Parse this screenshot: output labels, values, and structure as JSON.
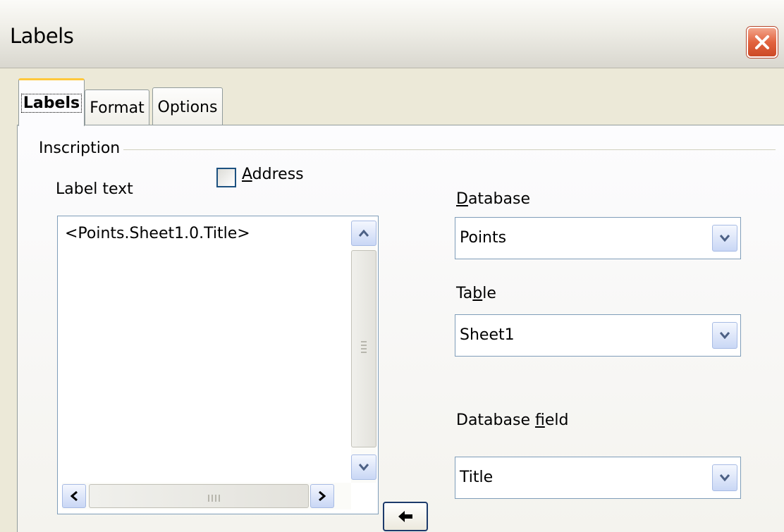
{
  "window": {
    "title": "Labels",
    "close_icon": "close-x-icon"
  },
  "tabs": [
    {
      "label": "Labels",
      "active": true
    },
    {
      "label": "Format",
      "active": false
    },
    {
      "label": "Options",
      "active": false
    }
  ],
  "inscription": {
    "group_title": "Inscription",
    "label_text_caption": "Label text",
    "address_checkbox": {
      "label": "Address",
      "checked": false
    },
    "label_text_value": "<Points.Sheet1.0.Title>"
  },
  "database": {
    "label": "Database",
    "value": "Points"
  },
  "table": {
    "label": "Table",
    "value": "Sheet1"
  },
  "database_field": {
    "label": "Database field",
    "value": "Title"
  },
  "insert_button_icon": "arrow-left-icon",
  "colors": {
    "dialog_bg": "#ece9d8",
    "close_button": "#e2633f",
    "active_tab_accent": "#ffc83d",
    "field_border": "#7f9db9"
  }
}
